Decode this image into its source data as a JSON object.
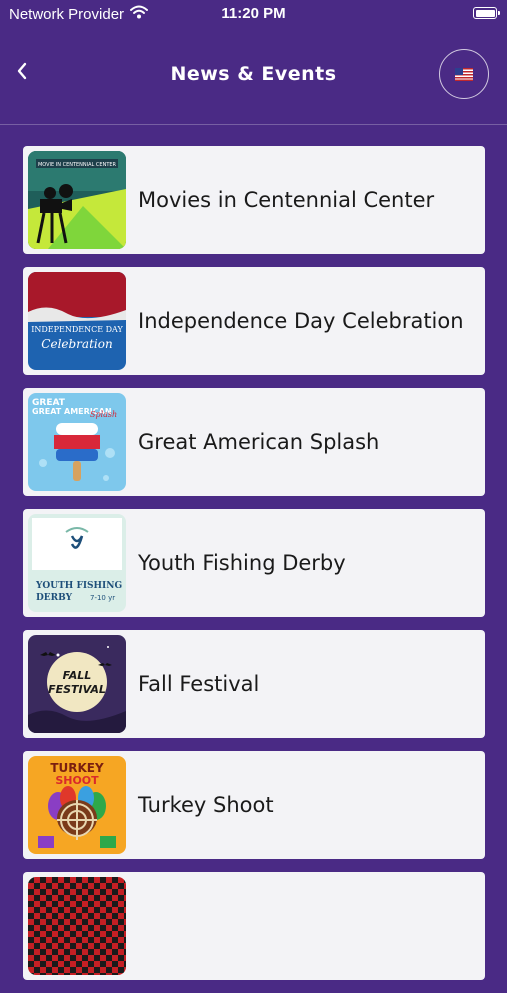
{
  "status_bar": {
    "carrier": "Network Provider",
    "time": "11:20 PM",
    "wifi_icon": "wifi-icon",
    "battery_icon": "battery-icon"
  },
  "header": {
    "title": "News & Events",
    "back_icon": "chevron-left-icon",
    "language_icon": "us-flag-icon"
  },
  "colors": {
    "background": "#4a2a85",
    "card": "#f3f3f6",
    "text_dark": "#1a1a1a"
  },
  "events": [
    {
      "title": "Movies in Centennial Center",
      "thumb_text": "MOVIE IN CENTENNIAL CENTER"
    },
    {
      "title": "Independence Day Celebration",
      "thumb_text_1": "INDEPENDENCE DAY",
      "thumb_text_2": "Celebration"
    },
    {
      "title": "Great American Splash",
      "thumb_text": "GREAT AMERICAN",
      "thumb_text_2": "Splash"
    },
    {
      "title": "Youth Fishing Derby",
      "thumb_text_1": "YOUTH FISHING",
      "thumb_text_2": "DERBY",
      "thumb_text_3": "7-10 yr"
    },
    {
      "title": "Fall Festival",
      "thumb_text_1": "FALL",
      "thumb_text_2": "FESTIVAL"
    },
    {
      "title": "Turkey Shoot",
      "thumb_text_1": "TURKEY",
      "thumb_text_2": "SHOOT"
    },
    {
      "title": ""
    }
  ]
}
